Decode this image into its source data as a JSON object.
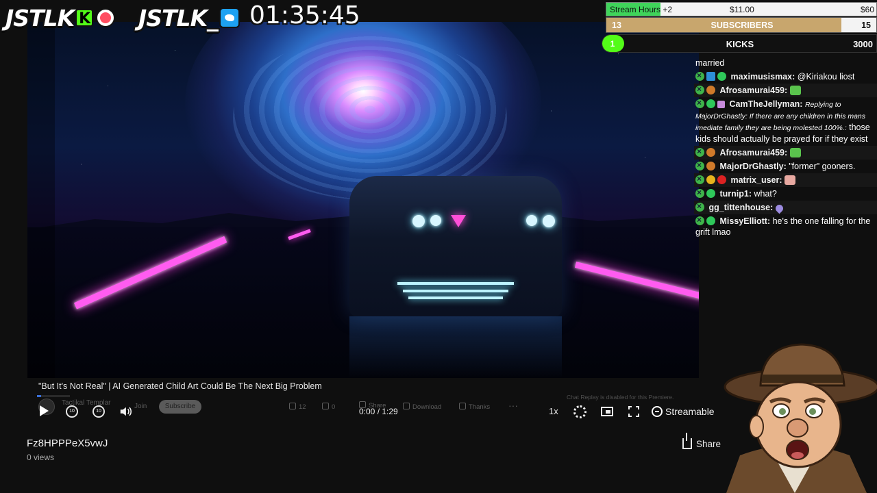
{
  "branding": {
    "handle_kick": "JSTLK",
    "kick_glyph": "K",
    "handle_twitter": "JSTLK_",
    "stream_clock": "01:35:45",
    "colors": {
      "kick": "#53fc18",
      "twitter": "#1da1f2",
      "record": "#ff4d61"
    }
  },
  "goals": {
    "stream_hours": {
      "label": "Stream Hours +2",
      "current": "$11.00",
      "target": "$60",
      "progress": 0.2
    },
    "subscribers": {
      "current": "13",
      "label": "SUBSCRIBERS",
      "target": "15",
      "progress": 0.87
    },
    "kicks": {
      "current": "1",
      "label": "KICKS",
      "target": "3000",
      "progress": 0.01
    }
  },
  "chat": {
    "messages": [
      {
        "user": "",
        "text": "married",
        "alt": false
      },
      {
        "user": "maximusismax:",
        "text": "@Kiriakou liost",
        "alt": false
      },
      {
        "user": "Afrosamurai459:",
        "text": "",
        "alt": true
      },
      {
        "user": "CamTheJellyman:",
        "reply": "Replying to MajorDrGhastly: If there are any children in this mans imediate family they are being molested 100%.:",
        "text": "those kids should actually be prayed for if they exist",
        "alt": false
      },
      {
        "user": "Afrosamurai459:",
        "text": "",
        "alt": true
      },
      {
        "user": "MajorDrGhastly:",
        "text": "\"former\" gooners.",
        "alt": false
      },
      {
        "user": "matrix_user:",
        "text": "",
        "alt": true
      },
      {
        "user": "turnip1:",
        "text": "what?",
        "alt": false
      },
      {
        "user": "gg_tittenhouse:",
        "text": "",
        "alt": true
      },
      {
        "user": "MissyElliott:",
        "text": "he's the one falling for the grift lmao",
        "alt": false
      }
    ]
  },
  "video": {
    "inner_title": "\"But It's Not Real\" | AI Generated Child Art Could Be The Next Big Problem",
    "channel": "Tactikal Templar",
    "join": "Join",
    "subscribe": "Subscribe",
    "likes": "12",
    "dislikes": "0",
    "share_ghost": "Share",
    "download": "Download",
    "thanks": "Thanks",
    "chat_replay_note": "Chat Replay is disabled for this Premiere.",
    "skip_back": "10",
    "skip_fwd": "10",
    "time": "0:00 / 1:29",
    "speed": "1x",
    "provider": "Streamable",
    "progress": 0.0
  },
  "page": {
    "title": "Fz8HPPPeX5vwJ",
    "views": "0 views",
    "share": "Share"
  }
}
